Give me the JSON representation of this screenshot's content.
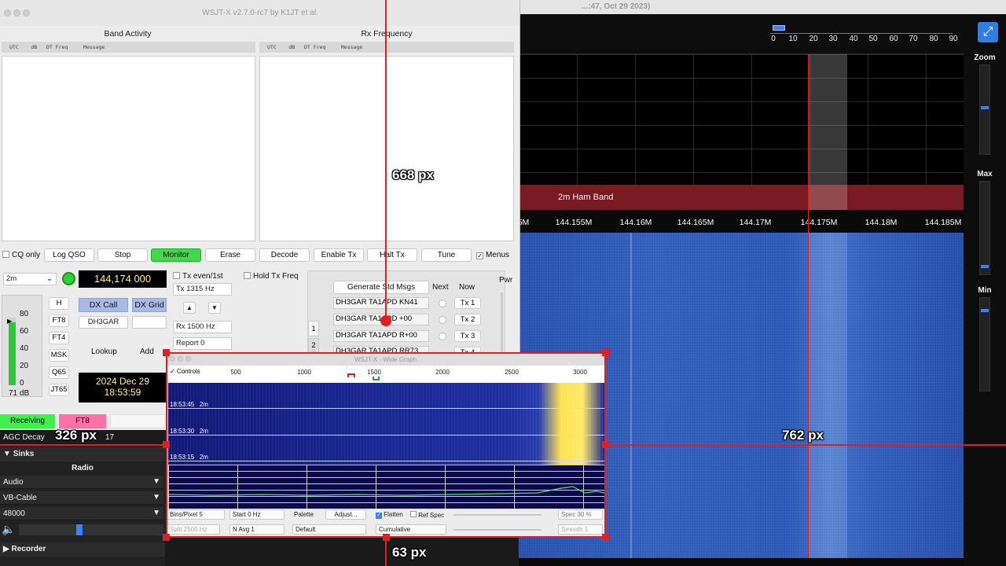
{
  "sdr": {
    "title": "...:47, Oct 29 2023)",
    "scale_ticks": [
      "0",
      "10",
      "20",
      "30",
      "40",
      "50",
      "60",
      "70",
      "80",
      "90"
    ],
    "band_label": "2m Ham Band",
    "freq_ticks": [
      "5M",
      "144.155M",
      "144.16M",
      "144.165M",
      "144.17M",
      "144.175M",
      "144.18M",
      "144.185M"
    ],
    "zoom_label": "Zoom",
    "max_label": "Max",
    "min_label": "Min",
    "fullscreen_icon": "expand-icon"
  },
  "wsjtx": {
    "title": "WSJT-X   v2.7.0-rc7   by K1JT et al.",
    "band_activity": "Band Activity",
    "rx_frequency": "Rx Frequency",
    "col_header": "UTC    dB   DT Freq     Message",
    "buttons": {
      "cq_only": "CQ only",
      "log_qso": "Log QSO",
      "stop": "Stop",
      "monitor": "Monitor",
      "erase": "Erase",
      "decode": "Decode",
      "enable_tx": "Enable Tx",
      "halt_tx": "Halt Tx",
      "tune": "Tune",
      "menus": "Menus"
    },
    "band": "2m",
    "dial_freq": "144,174 000",
    "tx_even": "Tx even/1st",
    "hold_tx": "Hold Tx Freq",
    "tx_freq": "Tx  1315  Hz",
    "rx_freq": "Rx  1500  Hz",
    "report": "Report  0",
    "modes": [
      "H",
      "FT8",
      "FT4",
      "MSK",
      "Q65",
      "JT65"
    ],
    "dx_call_btn": "DX Call",
    "dx_grid_btn": "DX Grid",
    "dx_call_value": "DH3GAR",
    "lookup": "Lookup",
    "add": "Add",
    "date": "2024 Dec 29",
    "time": "18:53:59",
    "meter_ticks": [
      "80",
      "60",
      "40",
      "20",
      "0"
    ],
    "meter_db": "71 dB",
    "generate_std": "Generate Std Msgs",
    "next": "Next",
    "now": "Now",
    "pwr": "Pwr",
    "messages": [
      "DH3GAR TA1APD KN41",
      "DH3GAR TA1APD +00",
      "DH3GAR TA1APD R+00",
      "DH3GAR TA1APD RR73"
    ],
    "tx_buttons": [
      "Tx 1",
      "Tx 2",
      "Tx 3",
      "Tx 4"
    ],
    "tabs": [
      "1",
      "2"
    ],
    "status_receiving": "Receiving",
    "status_mode": "FT8"
  },
  "sidebar": {
    "agc_decay": "AGC Decay",
    "agc_value": "17",
    "sinks": "Sinks",
    "radio": "Radio",
    "audio": "Audio",
    "vb_cable": "VB-Cable",
    "rate": "48000",
    "recorder": "Recorder"
  },
  "widegraph": {
    "title": "WSJT-X - Wide Graph",
    "controls": "Controls",
    "ticks": [
      "500",
      "1000",
      "1500",
      "2000",
      "2500",
      "3000"
    ],
    "timestamps": [
      "18:53:45",
      "18:53:30",
      "18:53:15"
    ],
    "ts_suffix": "2m",
    "bins": "Bins/Pixel  5",
    "start": "Start 0 Hz",
    "palette": "Palette",
    "adjust": "Adjust...",
    "flatten": "Flatten",
    "ref_spec": "Ref Spec",
    "spec": "Spec 30 %",
    "split": "Split  2500  Hz",
    "navg": "N Avg 1",
    "default": "Default",
    "cumulative": "Cumulative",
    "smooth": "Smooth  1"
  },
  "annotations": {
    "a668": "668 px",
    "a326": "326 px",
    "a762": "762 px",
    "a63": "63 px"
  }
}
